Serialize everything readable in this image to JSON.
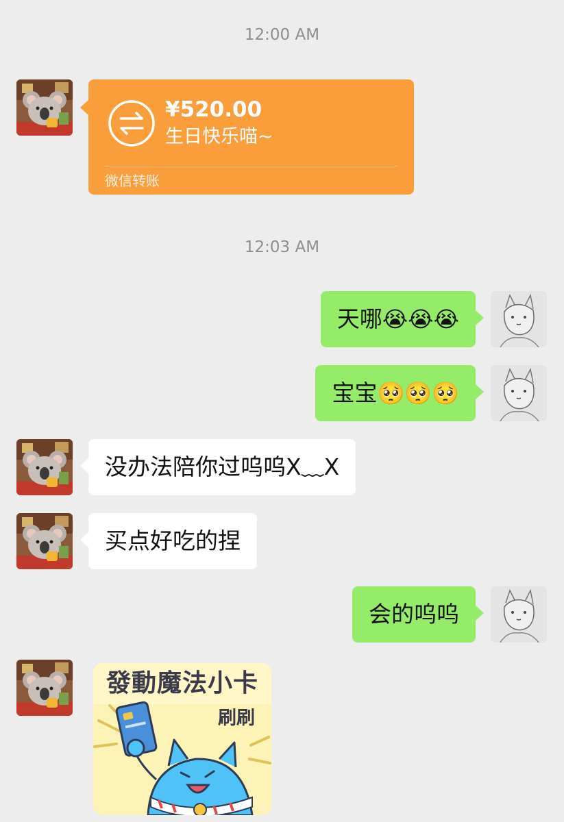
{
  "colors": {
    "background": "#ededed",
    "incoming_bubble": "#ffffff",
    "outgoing_bubble": "#95ec69",
    "transfer_card": "#fa9d3b",
    "timestamp_text": "#8e8e8e"
  },
  "timestamps": [
    "12:00 AM",
    "12:03 AM"
  ],
  "transfer": {
    "amount": "¥520.00",
    "note": "生日快乐喵~",
    "label": "微信转账",
    "icon": "transfer-arrows-icon"
  },
  "messages": [
    {
      "side": "right",
      "text": "天哪",
      "emoji": [
        "😭",
        "😭",
        "😭"
      ]
    },
    {
      "side": "right",
      "text": "宝宝",
      "emoji": [
        "🥺",
        "🥺",
        "🥺"
      ]
    },
    {
      "side": "left",
      "text": "没办法陪你过呜呜X﹏X"
    },
    {
      "side": "left",
      "text": "买点好吃的捏"
    },
    {
      "side": "right",
      "text": "会的呜呜"
    }
  ],
  "sticker": {
    "title": "發動魔法小卡",
    "sub": "刷刷"
  },
  "avatars": {
    "contact": "koala-avatar",
    "self": "sketch-fox-avatar"
  }
}
